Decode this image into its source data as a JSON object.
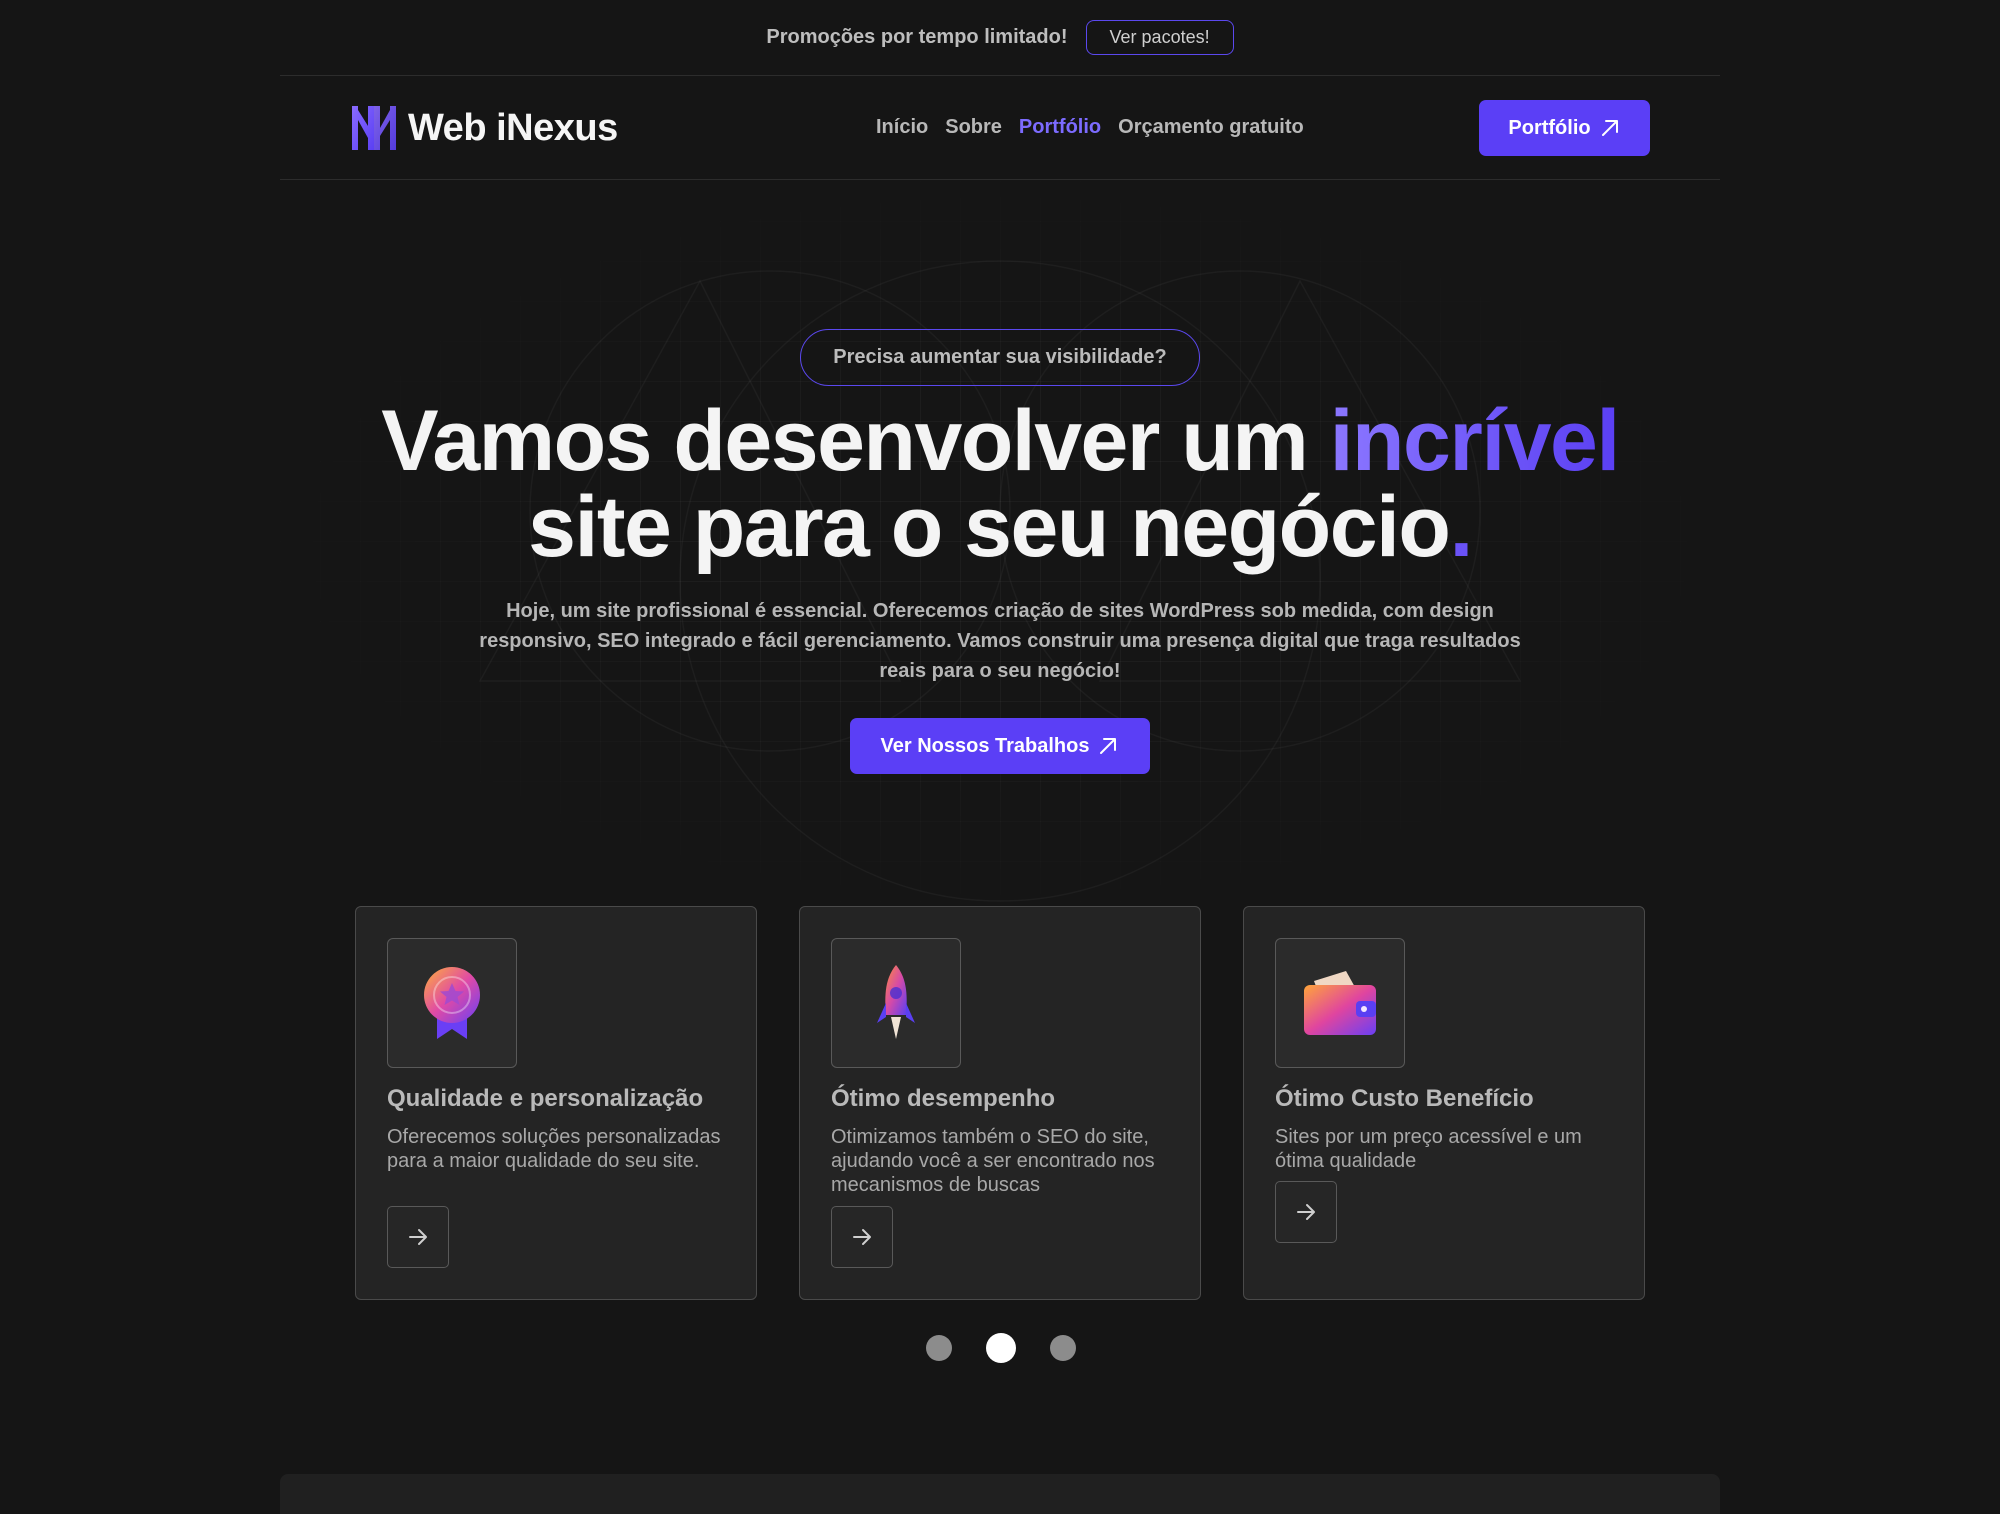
{
  "promo": {
    "text": "Promoções por tempo limitado!",
    "button": "Ver pacotes!"
  },
  "header": {
    "logo_text": "Web iNexus",
    "nav": [
      "Início",
      "Sobre",
      "Portfólio",
      "Orçamento gratuito"
    ],
    "nav_active": "Portfólio",
    "cta": "Portfólio"
  },
  "hero": {
    "pill": "Precisa aumentar sua visibilidade?",
    "headline_part1": "Vamos desenvolver um ",
    "headline_accent": "incrível",
    "headline_part2": "site para o seu negócio",
    "headline_dot": ".",
    "description": "Hoje, um site profissional é essencial. Oferecemos criação de sites WordPress sob medida, com design responsivo, SEO integrado e fácil gerenciamento. Vamos construir uma presença digital que traga resultados reais para o seu negócio!",
    "cta": "Ver Nossos Trabalhos"
  },
  "cards": [
    {
      "title": "Qualidade e personalização",
      "description": "Oferecemos soluções personalizadas para a maior qualidade do seu site.",
      "icon": "medal-icon"
    },
    {
      "title": "Ótimo desempenho",
      "description": "Otimizamos também o SEO do site, ajudando você a ser encontrado nos mecanismos de buscas",
      "icon": "rocket-icon"
    },
    {
      "title": "Ótimo Custo Benefício",
      "description": "Sites por um preço acessível e um ótima qualidade",
      "icon": "wallet-icon"
    }
  ],
  "pagination": {
    "total": 3,
    "active": 2
  },
  "colors": {
    "background": "#151515",
    "accent": "#5b3ff6",
    "accent_light": "#7c6bff",
    "card": "#242424"
  }
}
